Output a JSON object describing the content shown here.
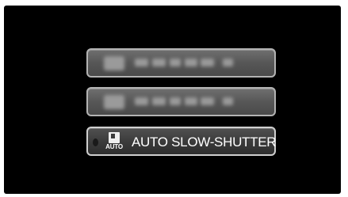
{
  "menu": {
    "items": [
      {
        "state": "obscured"
      },
      {
        "state": "obscured"
      },
      {
        "state": "selected",
        "label": "AUTO SLOW-SHUTTER",
        "icon": "auto-slow-shutter-icon",
        "icon_text": "AUTO"
      }
    ]
  },
  "colors": {
    "screen_background": "#000000",
    "button_border": "#b3b3b3",
    "button_fill": "#575757",
    "text": "#ffffff"
  }
}
